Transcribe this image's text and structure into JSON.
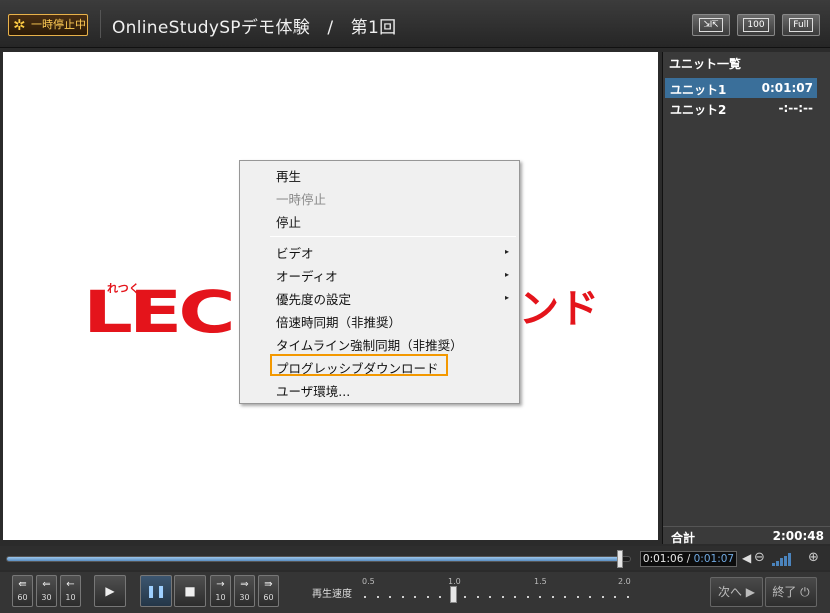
{
  "header": {
    "status_badge": "一時停止中",
    "title": "OnlineStudySPデモ体験　/　第1回",
    "buttons": [
      "",
      "100",
      "Full"
    ]
  },
  "video": {
    "logo_left": "LEC",
    "logo_small": "れつく",
    "logo_right": "ンド"
  },
  "context_menu": {
    "items": [
      {
        "label": "再生",
        "disabled": false
      },
      {
        "label": "一時停止",
        "disabled": true
      },
      {
        "label": "停止",
        "disabled": false
      },
      {
        "label": "ビデオ",
        "submenu": true
      },
      {
        "label": "オーディオ",
        "submenu": true
      },
      {
        "label": "優先度の設定",
        "submenu": true
      },
      {
        "label": "倍速時同期（非推奨）"
      },
      {
        "label": "タイムライン強制同期（非推奨）"
      },
      {
        "label": "プログレッシブダウンロード",
        "highlighted": true
      },
      {
        "label": "ユーザ環境..."
      }
    ],
    "submenu_arrow": "▸"
  },
  "sidebar": {
    "header": "ユニット一覧",
    "units": [
      {
        "name": "ユニット1",
        "time": "0:01:07",
        "selected": true
      },
      {
        "name": "ユニット2",
        "time": "-:--:--",
        "selected": false
      }
    ],
    "total_label": "合計",
    "total_time": "2:00:48"
  },
  "seek": {
    "current": "0:01:06",
    "separator": "/",
    "total": "0:01:07",
    "progress": 0.985
  },
  "volume": {
    "level_bars": 5,
    "of": 5
  },
  "controls": {
    "rewind": [
      "60",
      "30",
      "10"
    ],
    "forward": [
      "10",
      "30",
      "60"
    ],
    "speed_label": "再生速度",
    "speed_ticks": [
      "0.5",
      "1.0",
      "1.5",
      "2.0"
    ],
    "speed_value": 1.0,
    "next_label": "次へ",
    "end_label": "終了"
  }
}
